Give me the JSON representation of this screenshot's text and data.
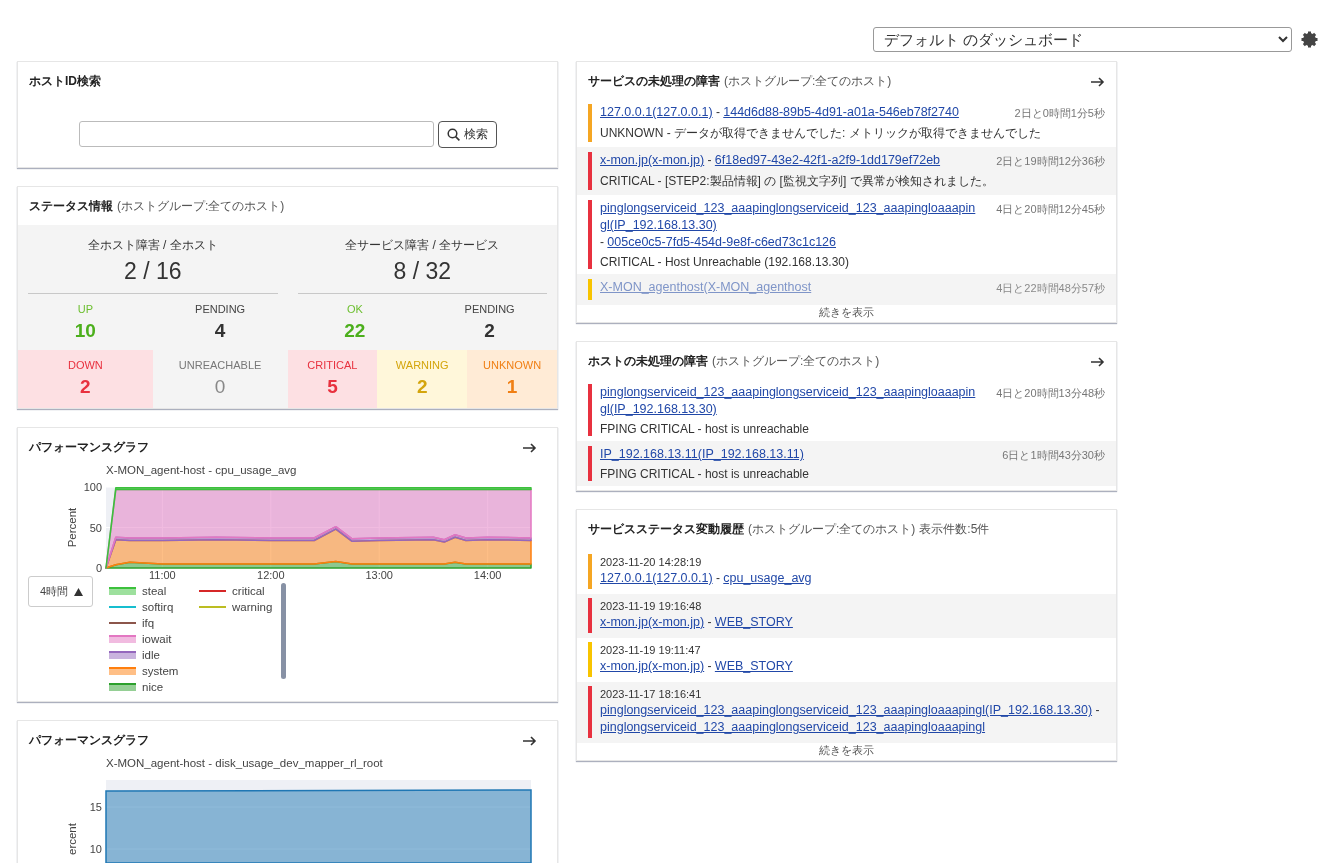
{
  "dashboard_select": {
    "value": "デフォルト のダッシュボード"
  },
  "host_search": {
    "title": "ホストID検索",
    "button": "検索"
  },
  "status_info": {
    "title": "ステータス情報",
    "scope": "(ホストグループ:全てのホスト)",
    "groups": [
      {
        "caption": "全ホスト障害 / 全ホスト",
        "total": "2 / 16",
        "top": [
          {
            "kind": "up",
            "label": "UP",
            "count": "10"
          },
          {
            "kind": "pending",
            "label": "PENDING",
            "count": "4"
          }
        ],
        "bottom": [
          {
            "kind": "down",
            "label": "DOWN",
            "count": "2"
          },
          {
            "kind": "unreachable",
            "label": "UNREACHABLE",
            "count": "0"
          }
        ]
      },
      {
        "caption": "全サービス障害 / 全サービス",
        "total": "8 / 32",
        "top": [
          {
            "kind": "ok",
            "label": "OK",
            "count": "22"
          },
          {
            "kind": "pending",
            "label": "PENDING",
            "count": "2"
          }
        ],
        "bottom": [
          {
            "kind": "critical",
            "label": "CRITICAL",
            "count": "5"
          },
          {
            "kind": "warning",
            "label": "WARNING",
            "count": "2"
          },
          {
            "kind": "unknown",
            "label": "UNKNOWN",
            "count": "1"
          }
        ]
      }
    ]
  },
  "perf_graphs": [
    {
      "title": "パフォーマンスグラフ",
      "range": "4時間",
      "chart_data": {
        "type": "area",
        "title": "X-MON_agent-host - cpu_usage_avg",
        "ylabel": "Percent",
        "stacked": true,
        "x": [
          10.48,
          10.57,
          10.7,
          11,
          11.5,
          12,
          12.4,
          12.6,
          12.75,
          13,
          13.5,
          13.6,
          13.7,
          13.8,
          14,
          14.4
        ],
        "xlim": [
          10.48,
          14.4
        ],
        "ylim": [
          0,
          100
        ],
        "yticks": [
          0,
          50,
          100
        ],
        "grid": true,
        "xticks": [
          {
            "value": 11,
            "label": "11:00"
          },
          {
            "value": 12,
            "label": "12:00"
          },
          {
            "value": 13,
            "label": "13:00"
          },
          {
            "value": 14,
            "label": "14:00"
          }
        ],
        "series": [
          {
            "name": "nice",
            "color": "#2ca02c",
            "values": [
              0,
              4,
              7,
              5,
              5,
              5,
              5,
              8,
              5,
              5,
              5,
              5,
              7,
              5,
              5,
              5
            ]
          },
          {
            "name": "system",
            "color": "#ff7f0e",
            "values": [
              0,
              31,
              27,
              29,
              30,
              29,
              29,
              40,
              28,
              29,
              30,
              27,
              31,
              29,
              30,
              29
            ]
          },
          {
            "name": "idle",
            "color": "#9467bd",
            "values": [
              0,
              3,
              3,
              3,
              3,
              3,
              3,
              3,
              3,
              3,
              3,
              3,
              3,
              3,
              3,
              3
            ]
          },
          {
            "name": "iowait",
            "color": "#e377c2",
            "values": [
              0,
              59,
              60,
              60,
              59,
              60,
              60,
              46,
              61,
              60,
              59,
              62,
              56,
              60,
              59,
              60
            ]
          },
          {
            "name": "ifq",
            "color": "#8c564b",
            "values": [
              null,
              null,
              null,
              null,
              null,
              null,
              null,
              null,
              null,
              null,
              null,
              null,
              null,
              null,
              null,
              null
            ]
          },
          {
            "name": "softirq",
            "color": "#17becf",
            "values": [
              null,
              null,
              null,
              null,
              null,
              null,
              null,
              null,
              null,
              null,
              null,
              null,
              null,
              null,
              null,
              null
            ]
          },
          {
            "name": "steal",
            "color": "#3cc13c",
            "values": [
              0,
              2,
              2,
              2,
              2,
              2,
              2,
              2,
              2,
              2,
              2,
              2,
              2,
              2,
              2,
              2
            ]
          },
          {
            "name": "critical",
            "color": "#d62728",
            "values": [
              null,
              null,
              null,
              null,
              null,
              null,
              null,
              null,
              null,
              null,
              null,
              null,
              null,
              null,
              null,
              null
            ]
          },
          {
            "name": "warning",
            "color": "#bcbd22",
            "values": [
              null,
              null,
              null,
              null,
              null,
              null,
              null,
              null,
              null,
              null,
              null,
              null,
              null,
              null,
              null,
              null
            ]
          }
        ]
      }
    },
    {
      "title": "パフォーマンスグラフ",
      "graph": {
        "title": "X-MON_agent-host - disk_usage_dev_mapper_rl_root",
        "axis_title": "ercent",
        "tick_labels": [
          "15",
          "10"
        ]
      }
    }
  ],
  "service_problems": {
    "title": "サービスの未処理の障害",
    "scope": "(ホストグループ:全てのホスト)",
    "items": [
      {
        "color": "#f5a623",
        "faded": false,
        "host": "127.0.0.1(127.0.0.1)",
        "separator": "-",
        "service": "144d6d88-89b5-4d91-a01a-546eb78f2740",
        "duration": "2日と0時間1分5秒",
        "message": "UNKNOWN - データが取得できませんでした: メトリックが取得できませんでした"
      },
      {
        "color": "#e8313f",
        "faded": false,
        "host": "x-mon.jp(x-mon.jp)",
        "separator": "-",
        "service": "6f18ed97-43e2-42f1-a2f9-1dd179ef72eb",
        "duration": "2日と19時間12分36秒",
        "message": "CRITICAL - [STEP2:製品情報] の [監視文字列] で異常が検知されました。"
      },
      {
        "color": "#e8313f",
        "faded": false,
        "host": "pinglongserviceid_123_aaapinglongserviceid_123_aaapingloaaapingl(IP_192.168.13.30)",
        "separator": "-",
        "service": "005ce0c5-7fd5-454d-9e8f-c6ed73c1c126",
        "duration": "4日と20時間12分45秒",
        "message": "CRITICAL - Host Unreachable (192.168.13.30)"
      },
      {
        "color": "#f8c400",
        "faded": true,
        "host": "X-MON_agenthost(X-MON_agenthost",
        "duration": "4日と22時間48分57秒"
      }
    ],
    "more": "続きを表示"
  },
  "host_problems": {
    "title": "ホストの未処理の障害",
    "scope": "(ホストグループ:全てのホスト)",
    "items": [
      {
        "color": "#e8313f",
        "host": "pinglongserviceid_123_aaapinglongserviceid_123_aaapingloaaapingl(IP_192.168.13.30)",
        "duration": "4日と20時間13分48秒",
        "message": "FPING CRITICAL - host is unreachable"
      },
      {
        "color": "#e8313f",
        "host": "IP_192.168.13.11(IP_192.168.13.11)",
        "duration": "6日と1時間43分30秒",
        "message": "FPING CRITICAL - host is unreachable"
      }
    ]
  },
  "history": {
    "title": "サービスステータス変動履歴",
    "scope": "(ホストグループ:全てのホスト)",
    "count": "表示件数:5件",
    "items": [
      {
        "color": "#f5a623",
        "time": "2023-11-20 14:28:19",
        "host": "127.0.0.1(127.0.0.1)",
        "separator": "-",
        "service": "cpu_usage_avg"
      },
      {
        "color": "#e8313f",
        "time": "2023-11-19 19:16:48",
        "host": "x-mon.jp(x-mon.jp)",
        "separator": "-",
        "service": "WEB_STORY"
      },
      {
        "color": "#f8c400",
        "time": "2023-11-19 19:11:47",
        "host": "x-mon.jp(x-mon.jp)",
        "separator": "-",
        "service": "WEB_STORY"
      },
      {
        "color": "#e8313f",
        "time": "2023-11-17 18:16:41",
        "host": "pinglongserviceid_123_aaapinglongserviceid_123_aaapingloaaapingl(IP_192.168.13.30)",
        "separator": "-",
        "service": "pinglongserviceid_123_aaapinglongserviceid_123_aaapingloaaapingl"
      }
    ],
    "more": "続きを表示"
  }
}
